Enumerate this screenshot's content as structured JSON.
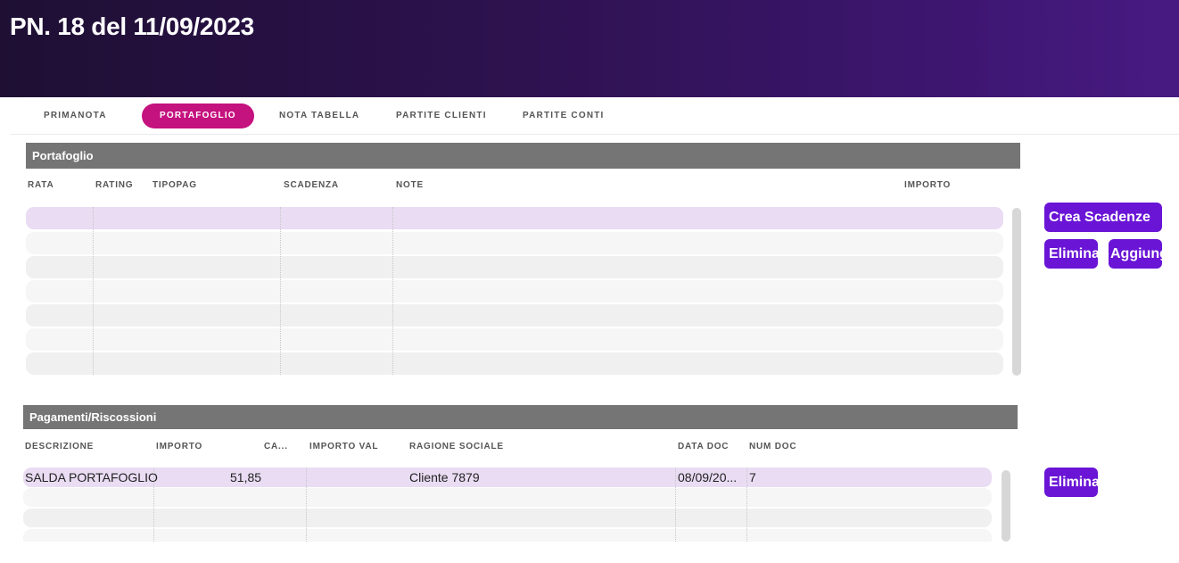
{
  "header": {
    "title": "PN. 18 del 11/09/2023"
  },
  "tabs": [
    {
      "label": "PRIMANOTA",
      "active": false
    },
    {
      "label": "PORTAFOGLIO",
      "active": true
    },
    {
      "label": "NOTA TABELLA",
      "active": false
    },
    {
      "label": "PARTITE CLIENTI",
      "active": false
    },
    {
      "label": "PARTITE CONTI",
      "active": false
    }
  ],
  "portafoglio": {
    "title": "Portafoglio",
    "columns": [
      "RATA",
      "RATING",
      "TIPOPAG",
      "SCADENZA",
      "NOTE",
      "IMPORTO"
    ],
    "rows": [
      {
        "rata": "",
        "rating": "",
        "tipopag": "",
        "scadenza": "",
        "note": "",
        "importo": ""
      },
      {
        "rata": "",
        "rating": "",
        "tipopag": "",
        "scadenza": "",
        "note": "",
        "importo": ""
      },
      {
        "rata": "",
        "rating": "",
        "tipopag": "",
        "scadenza": "",
        "note": "",
        "importo": ""
      },
      {
        "rata": "",
        "rating": "",
        "tipopag": "",
        "scadenza": "",
        "note": "",
        "importo": ""
      },
      {
        "rata": "",
        "rating": "",
        "tipopag": "",
        "scadenza": "",
        "note": "",
        "importo": ""
      },
      {
        "rata": "",
        "rating": "",
        "tipopag": "",
        "scadenza": "",
        "note": "",
        "importo": ""
      },
      {
        "rata": "",
        "rating": "",
        "tipopag": "",
        "scadenza": "",
        "note": "",
        "importo": ""
      }
    ]
  },
  "pagamenti": {
    "title": "Pagamenti/Riscossioni",
    "columns": [
      "DESCRIZIONE",
      "IMPORTO",
      "CA...",
      "IMPORTO VAL",
      "RAGIONE SOCIALE",
      "DATA DOC",
      "NUM DOC"
    ],
    "rows": [
      {
        "descrizione": "SALDA PORTAFOGLIO",
        "importo": "51,85",
        "ca": "",
        "importo_val": "",
        "ragione_sociale": "Cliente 7879",
        "data_doc": "08/09/20...",
        "num_doc": "7"
      },
      {
        "descrizione": "",
        "importo": "",
        "ca": "",
        "importo_val": "",
        "ragione_sociale": "",
        "data_doc": "",
        "num_doc": ""
      },
      {
        "descrizione": "",
        "importo": "",
        "ca": "",
        "importo_val": "",
        "ragione_sociale": "",
        "data_doc": "",
        "num_doc": ""
      },
      {
        "descrizione": "",
        "importo": "",
        "ca": "",
        "importo_val": "",
        "ragione_sociale": "",
        "data_doc": "",
        "num_doc": ""
      }
    ]
  },
  "buttons": {
    "crea_scadenze": "Crea Scadenze",
    "elimina": "Elimina",
    "aggiungi": "Aggiungi",
    "elimina_pagamento": "Elimina"
  },
  "colors": {
    "header_gradient_start": "#1e0f33",
    "header_gradient_end": "#471a82",
    "tab_active": "#c4127e",
    "button": "#6a14d6",
    "panel_title_bg": "#757575",
    "selected_row": "#e9dcf3"
  }
}
